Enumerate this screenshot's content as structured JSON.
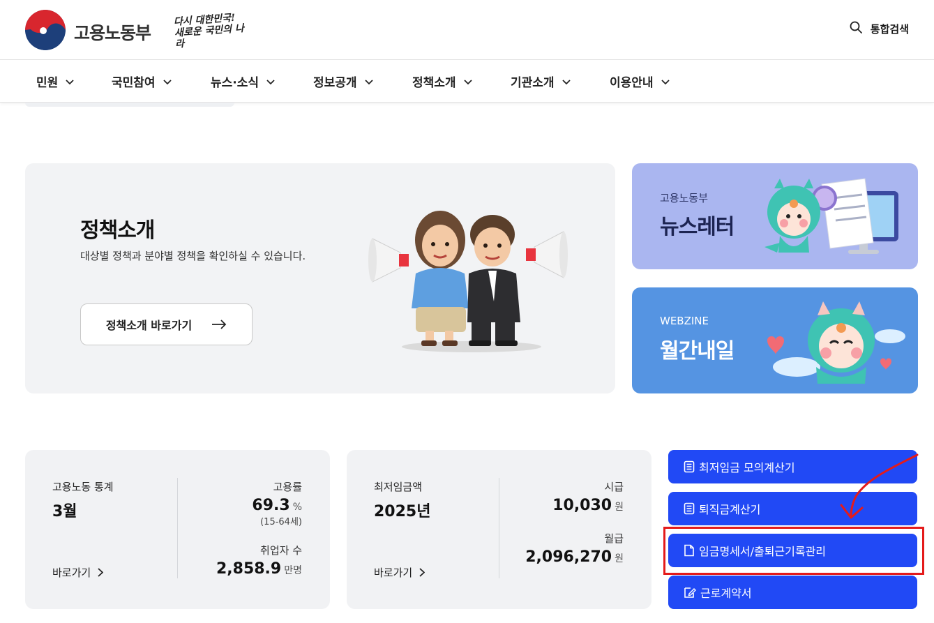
{
  "header": {
    "org_name": "고용노동부",
    "slogan_line1": "다시 대한민국!",
    "slogan_line2": "새로운 국민의 나라",
    "search_label": "통합검색",
    "search_icon": "search-icon"
  },
  "nav": {
    "items": [
      {
        "label": "민원"
      },
      {
        "label": "국민참여"
      },
      {
        "label": "뉴스·소식"
      },
      {
        "label": "정보공개"
      },
      {
        "label": "정책소개"
      },
      {
        "label": "기관소개"
      },
      {
        "label": "이용안내"
      }
    ]
  },
  "policy": {
    "title": "정책소개",
    "description": "대상별 정책과 분야별 정책을 확인하실 수 있습니다.",
    "button_label": "정책소개 바로가기"
  },
  "newsletter": {
    "subtitle": "고용노동부",
    "title": "뉴스레터"
  },
  "webzine": {
    "subtitle": "WEBZINE",
    "title": "월간내일"
  },
  "stats_labor": {
    "label": "고용노동 통계",
    "period": "3월",
    "link": "바로가기",
    "employment_rate_label": "고용률",
    "employment_rate_value": "69.3",
    "employment_rate_unit": "%",
    "employment_rate_note": "(15-64세)",
    "employed_label": "취업자 수",
    "employed_value": "2,858.9",
    "employed_unit": "만명"
  },
  "stats_wage": {
    "label": "최저임금액",
    "year": "2025년",
    "link": "바로가기",
    "hourly_label": "시급",
    "hourly_value": "10,030",
    "hourly_unit": "원",
    "monthly_label": "월급",
    "monthly_value": "2,096,270",
    "monthly_unit": "원"
  },
  "quick_buttons": [
    {
      "label": "최저임금 모의계산기",
      "icon": "calculator-icon"
    },
    {
      "label": "퇴직금계산기",
      "icon": "calculator-icon"
    },
    {
      "label": "임금명세서/출퇴근기록관리",
      "icon": "document-icon"
    },
    {
      "label": "근로계약서",
      "icon": "edit-document-icon"
    }
  ],
  "colors": {
    "quick_button_bg": "#2149f5",
    "newsletter_bg": "#aab6f0",
    "webzine_bg": "#5594e2",
    "annotation_red": "#e41b1b"
  }
}
